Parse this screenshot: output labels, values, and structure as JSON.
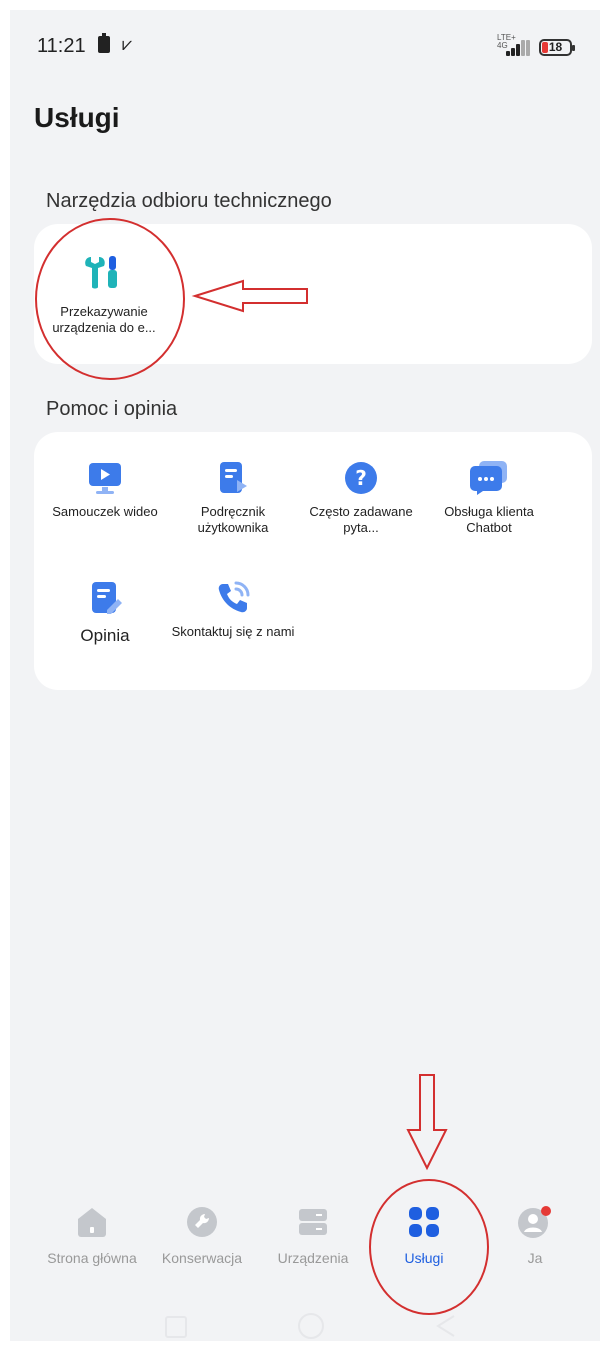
{
  "status_bar": {
    "time": "11:21",
    "network": "LTE+",
    "network_sub": "4G",
    "battery": "18"
  },
  "page": {
    "title": "Usługi"
  },
  "sections": [
    {
      "title": "Narzędzia odbioru technicznego",
      "items": [
        {
          "label": "Przekazywanie urządzenia do e...",
          "icon": "tools-icon"
        }
      ]
    },
    {
      "title": "Pomoc i opinia",
      "items": [
        {
          "label": "Samouczek wideo",
          "icon": "video-tutorial-icon"
        },
        {
          "label": "Podręcznik użytkownika",
          "icon": "user-manual-icon"
        },
        {
          "label": "Często zadawane pyta...",
          "icon": "faq-icon"
        },
        {
          "label": "Obsługa klienta Chatbot",
          "icon": "chatbot-icon"
        },
        {
          "label": "Opinia",
          "icon": "feedback-icon"
        },
        {
          "label": "Skontaktuj się z nami",
          "icon": "contact-phone-icon"
        }
      ]
    }
  ],
  "nav": [
    {
      "label": "Strona główna",
      "icon": "home-icon"
    },
    {
      "label": "Konserwacja",
      "icon": "wrench-icon"
    },
    {
      "label": "Urządzenia",
      "icon": "devices-icon"
    },
    {
      "label": "Usługi",
      "icon": "services-grid-icon",
      "active": true
    },
    {
      "label": "Ja",
      "icon": "profile-icon",
      "badge": true
    }
  ],
  "colors": {
    "accent": "#1f5fe0",
    "icon_blue": "#3d7bea",
    "tools_teal": "#1fb3b8",
    "annotation_red": "#d32f2f",
    "background": "#f2f3f5"
  }
}
